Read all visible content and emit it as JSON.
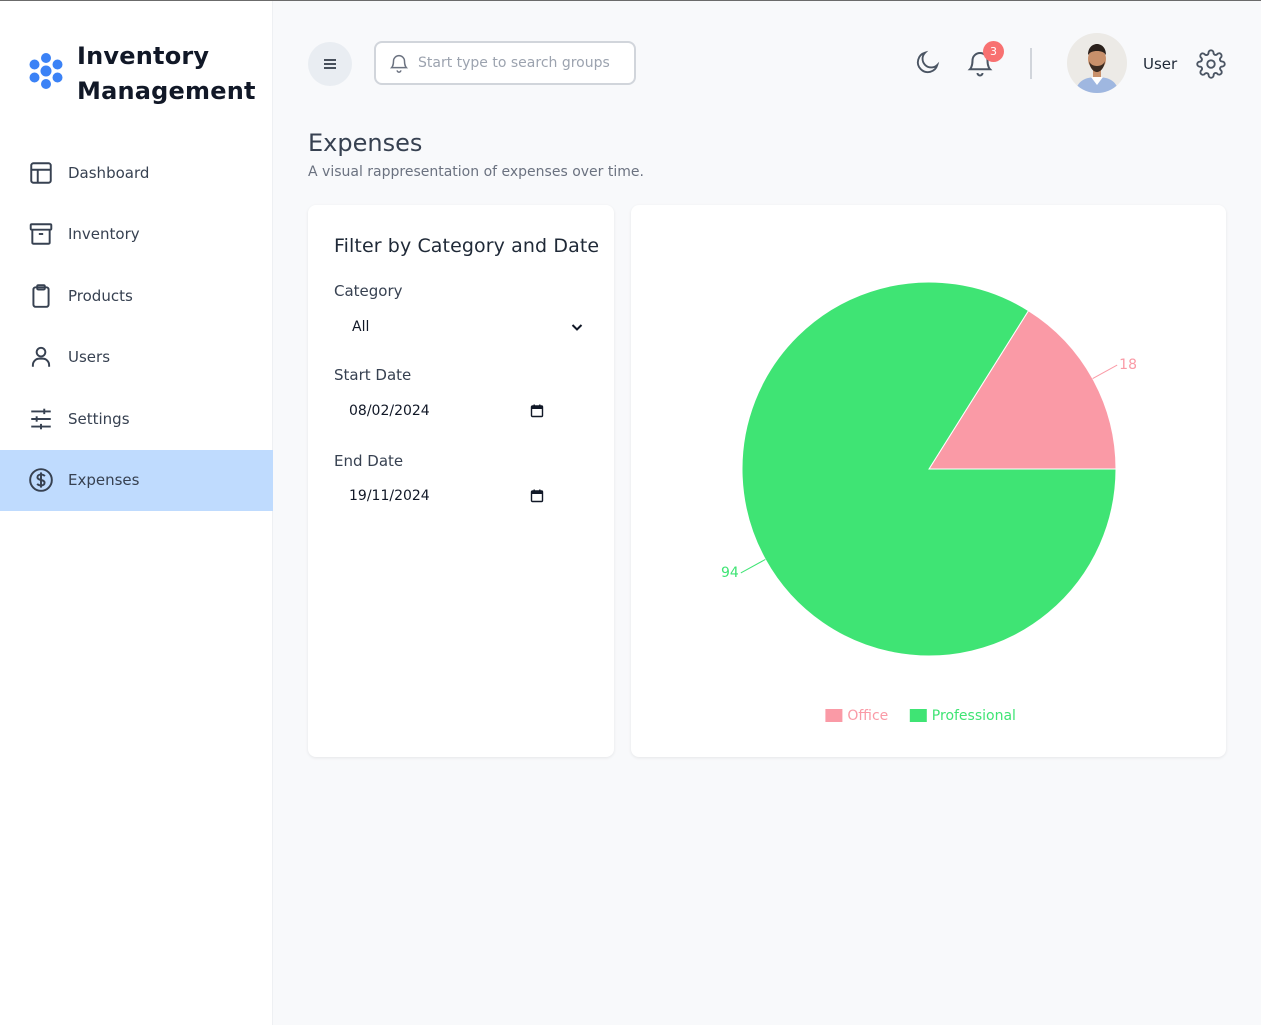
{
  "app": {
    "title_line1": "Inventory",
    "title_line2": "Management"
  },
  "sidebar": {
    "items": [
      {
        "label": "Dashboard",
        "icon": "layout-icon",
        "active": false
      },
      {
        "label": "Inventory",
        "icon": "archive-icon",
        "active": false
      },
      {
        "label": "Products",
        "icon": "clipboard-icon",
        "active": false
      },
      {
        "label": "Users",
        "icon": "user-icon",
        "active": false
      },
      {
        "label": "Settings",
        "icon": "sliders-icon",
        "active": false
      },
      {
        "label": "Expenses",
        "icon": "circle-dollar-icon",
        "active": true
      }
    ]
  },
  "header": {
    "search_placeholder": "Start type to search groups",
    "notification_count": "3",
    "username": "User"
  },
  "page": {
    "title": "Expenses",
    "subtitle": "A visual rappresentation of expenses over time."
  },
  "filter": {
    "title": "Filter by Category and Date",
    "category_label": "Category",
    "category_value": "All",
    "start_label": "Start Date",
    "start_value": "08/02/2024",
    "end_label": "End Date",
    "end_value": "19/11/2024"
  },
  "colors": {
    "accent_active": "#bfdbfe",
    "brand_blue": "#3b82f6",
    "office": "#fa9aa6",
    "professional": "#3fe474",
    "badge": "#f87171"
  },
  "chart_data": {
    "type": "pie",
    "categories": [
      "Office",
      "Professional"
    ],
    "values": [
      18,
      94
    ],
    "colors": [
      "#fa9aa6",
      "#3fe474"
    ],
    "legend": "bottom"
  }
}
